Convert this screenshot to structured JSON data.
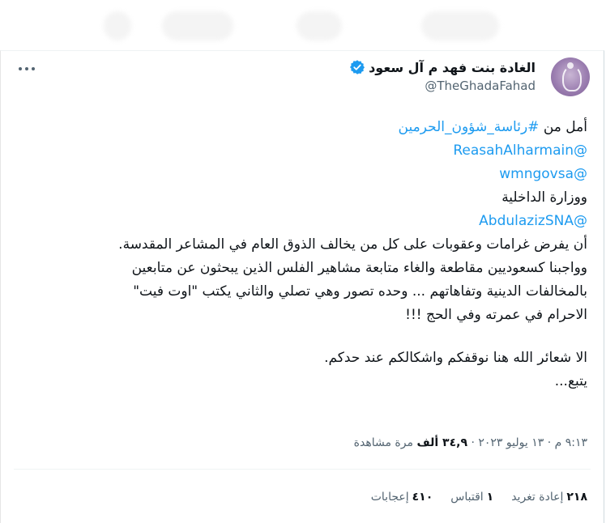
{
  "author": {
    "name": "الغادة بنت فهد م آل سعود",
    "handle": "@TheGhadaFahad"
  },
  "tweet": {
    "l1_text": "أمل من ",
    "l1_link": "#رئاسة_شؤون_الحرمين",
    "l2_link": "@ReasahAlharmain",
    "l3_link": "@wmngovsa",
    "l4_text": "ووزارة الداخلية",
    "l5_link": "@AbdulazizSNA",
    "l6": "أن يفرض غرامات وعقوبات على كل من يخالف الذوق العام في المشاعر المقدسة.",
    "l7": "وواجبنا كسعوديين مقاطعة والغاء متابعة مشاهير الفلس الذين يبحثون عن متابعين",
    "l8": "بالمخالفات الدينية وتفاهاتهم ... وحده تصور وهي تصلي والثاني يكتب \"اوت فيت\"",
    "l9": "الاحرام في عمرته وفي الحج !!!",
    "l10": "الا شعائر الله هنا نوقفكم واشكالكم عند حدكم.",
    "l11": "يتبع..."
  },
  "meta": {
    "time_date": "٩:١٣ م · ١٣ يوليو ٢٠٢٣ · ",
    "views_count": "٣٤,٩ ألف",
    "views_label": " مرة مشاهدة"
  },
  "stats": {
    "retweets_count": "٢١٨",
    "retweets_label": "إعادة تغريد",
    "quotes_count": "١",
    "quotes_label": "اقتباس",
    "likes_count": "٤١٠",
    "likes_label": "إعجابات"
  },
  "colors": {
    "link": "#1d9bf0",
    "verified": "#1d9bf0",
    "muted": "#536471"
  },
  "icons": {
    "verified": "verified-badge-icon",
    "more": "more-options-icon"
  }
}
